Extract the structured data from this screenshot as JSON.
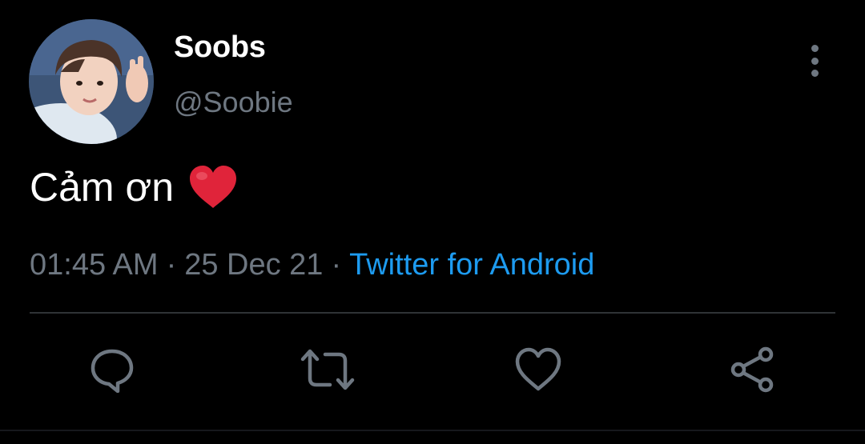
{
  "user": {
    "display_name": "Soobs",
    "handle": "@Soobie",
    "avatar": "avatar-photo"
  },
  "tweet": {
    "text": "Cảm ơn",
    "emoji": "red-heart-emoji",
    "time": "01:45 AM",
    "date": "25 Dec 21",
    "separator": "·",
    "source": "Twitter for Android"
  },
  "actions": {
    "reply": "reply-icon",
    "retweet": "retweet-icon",
    "like": "heart-icon",
    "share": "share-icon",
    "more": "more-vertical-icon"
  },
  "colors": {
    "background": "#000000",
    "primary_text": "#ffffff",
    "secondary_text": "#6e7781",
    "link": "#1d9bf0",
    "divider": "#2f3336",
    "heart_emoji": "#e0243a"
  }
}
